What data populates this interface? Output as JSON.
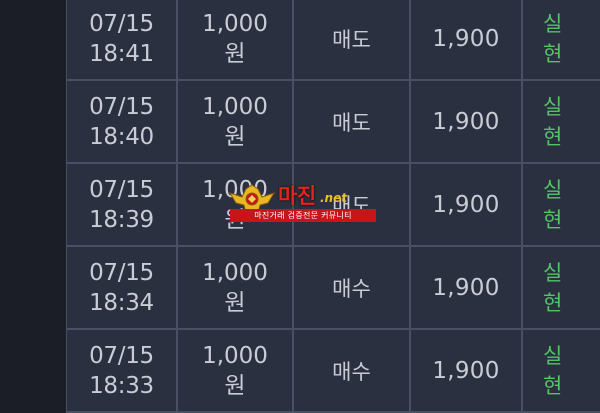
{
  "rows": [
    {
      "date": "07/15",
      "time": "18:41",
      "amount": "1,000",
      "currency": "원",
      "side": "매도",
      "price": "1,900",
      "status_1": "실",
      "status_2": "현"
    },
    {
      "date": "07/15",
      "time": "18:40",
      "amount": "1,000",
      "currency": "원",
      "side": "매도",
      "price": "1,900",
      "status_1": "실",
      "status_2": "현"
    },
    {
      "date": "07/15",
      "time": "18:39",
      "amount": "1,000",
      "currency": "원",
      "side": "매도",
      "price": "1,900",
      "status_1": "실",
      "status_2": "현"
    },
    {
      "date": "07/15",
      "time": "18:34",
      "amount": "1,000",
      "currency": "원",
      "side": "매수",
      "price": "1,900",
      "status_1": "실",
      "status_2": "현"
    },
    {
      "date": "07/15",
      "time": "18:33",
      "amount": "1,000",
      "currency": "원",
      "side": "매수",
      "price": "1,900",
      "status_1": "실",
      "status_2": "현"
    }
  ],
  "watermark": {
    "title": "마진",
    "suffix": ".net",
    "tagline": "마진거래 검증전문 커뮤니티",
    "icon": "eagle-emblem-icon"
  },
  "colors": {
    "background": "#1b1e27",
    "row_background": "#2b3040",
    "grid_line": "#4a5063",
    "text": "#c9ccd4",
    "status_green": "#52c466",
    "watermark_red": "#e2241c"
  }
}
